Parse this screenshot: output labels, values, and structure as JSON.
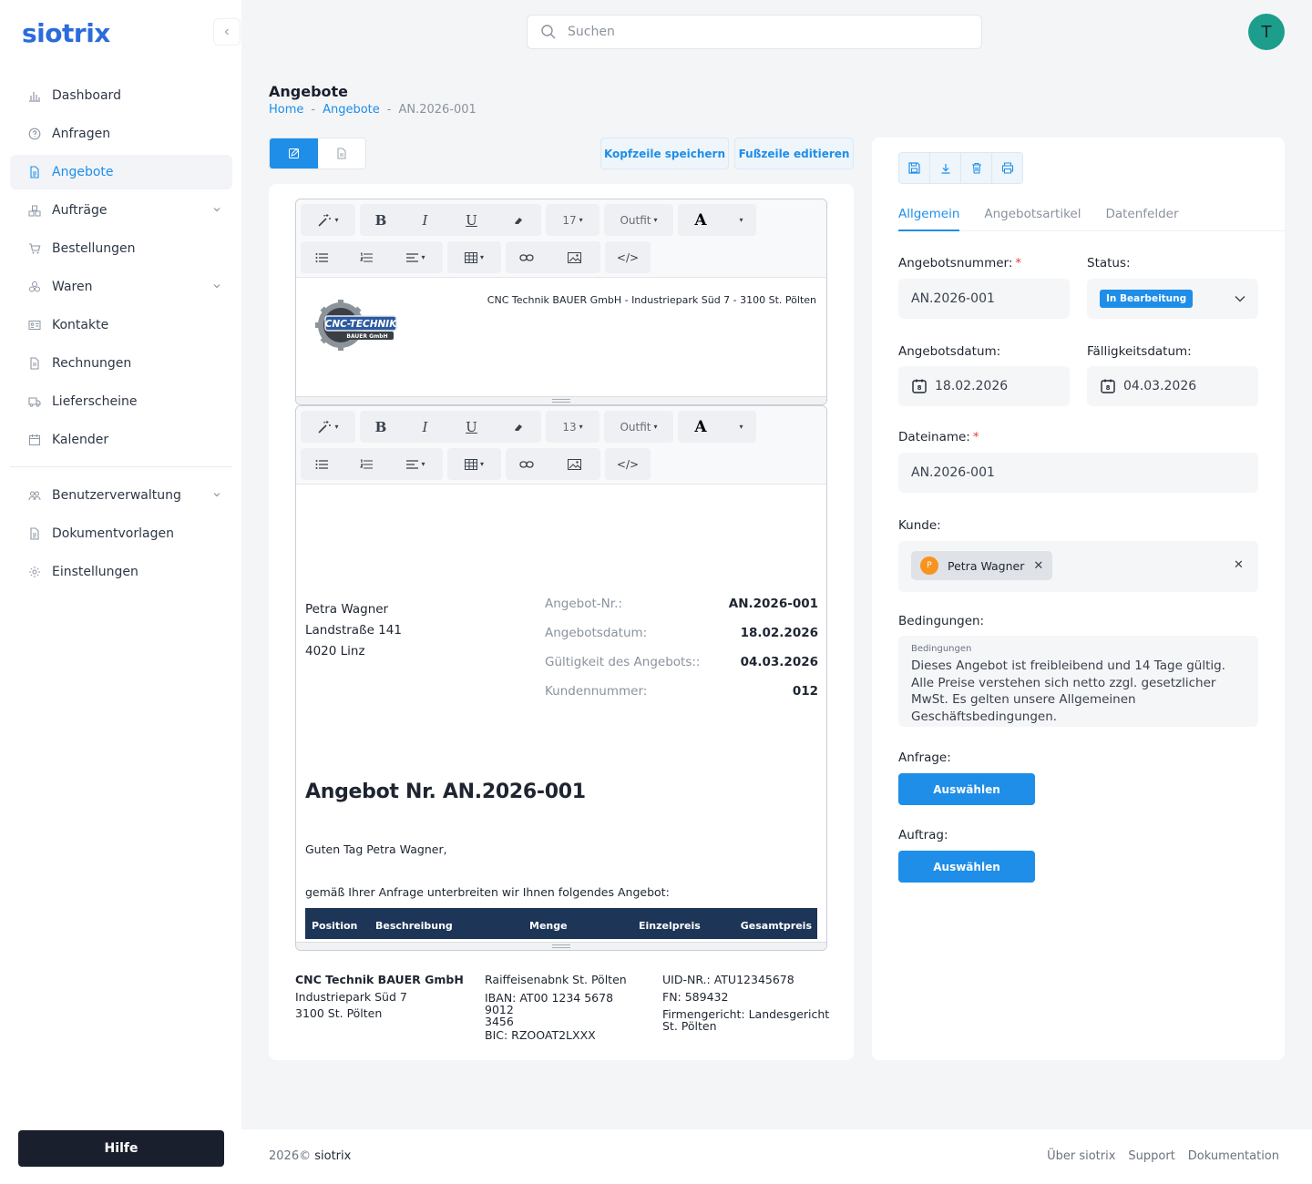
{
  "app": {
    "logo": "siotrix"
  },
  "search": {
    "placeholder": "Suchen"
  },
  "user": {
    "avatar_initial": "T"
  },
  "sidebar": {
    "items": [
      {
        "label": "Dashboard",
        "icon": "bar-chart-icon"
      },
      {
        "label": "Anfragen",
        "icon": "question-circle-icon"
      },
      {
        "label": "Angebote",
        "icon": "document-icon",
        "active": true
      },
      {
        "label": "Aufträge",
        "icon": "boxes-icon",
        "expandable": true
      },
      {
        "label": "Bestellungen",
        "icon": "cart-icon"
      },
      {
        "label": "Waren",
        "icon": "stack-icon",
        "expandable": true
      },
      {
        "label": "Kontakte",
        "icon": "contact-card-icon"
      },
      {
        "label": "Rechnungen",
        "icon": "invoice-icon"
      },
      {
        "label": "Lieferscheine",
        "icon": "truck-icon"
      },
      {
        "label": "Kalender",
        "icon": "calendar-icon"
      }
    ],
    "admin_items": [
      {
        "label": "Benutzerverwaltung",
        "icon": "users-icon",
        "expandable": true
      },
      {
        "label": "Dokumentvorlagen",
        "icon": "template-icon"
      },
      {
        "label": "Einstellungen",
        "icon": "gear-icon"
      }
    ],
    "help_label": "Hilfe"
  },
  "page": {
    "title": "Angebote",
    "breadcrumb": {
      "home": "Home",
      "section": "Angebote",
      "current": "AN.2026-001"
    }
  },
  "editor": {
    "save_header_label": "Kopfzeile speichern",
    "edit_footer_label": "Fußzeile editieren",
    "header_toolbar": {
      "font_size": "17",
      "font_family": "Outfit"
    },
    "body_toolbar": {
      "font_size": "13",
      "font_family": "Outfit"
    },
    "header_address": "CNC Technik BAUER GmbH - Industriepark Süd 7 - 3100 St. Pölten",
    "logo_text_main": "CNC-TECHNIK",
    "logo_text_sub": "BAUER GmbH"
  },
  "document": {
    "recipient": {
      "name": "Petra Wagner",
      "street": "Landstraße 141",
      "city": "4020 Linz"
    },
    "meta": [
      {
        "label": "Angebot-Nr.:",
        "value": "AN.2026-001"
      },
      {
        "label": "Angebotsdatum:",
        "value": "18.02.2026"
      },
      {
        "label": "Gültigkeit des Angebots::",
        "value": "04.03.2026"
      },
      {
        "label": "Kundennummer:",
        "value": "012"
      }
    ],
    "title": "Angebot Nr. AN.2026-001",
    "greeting": "Guten Tag Petra Wagner,",
    "intro": "gemäß Ihrer Anfrage unterbreiten wir Ihnen folgendes Angebot:",
    "table_headers": [
      "Position",
      "Beschreibung",
      "Menge",
      "Einzelpreis",
      "Gesamtpreis"
    ]
  },
  "doc_footer": {
    "col1": [
      "CNC Technik BAUER GmbH",
      "Industriepark Süd 7",
      "3100 St. Pölten"
    ],
    "col2": [
      "Raiffeisenabnk St. Pölten",
      "IBAN: AT00 1234 5678 9012",
      "3456",
      "BIC: RZOOAT2LXXX"
    ],
    "col3": [
      "UID-NR.: ATU12345678",
      "FN: 589432",
      "Firmengericht: Landesgericht",
      "St. Pölten"
    ]
  },
  "form": {
    "tabs": [
      "Allgemein",
      "Angebotsartikel",
      "Datenfelder"
    ],
    "offer_number_label": "Angebotsnummer:",
    "offer_number": "AN.2026-001",
    "status_label": "Status:",
    "status_value": "In Bearbeitung",
    "offer_date_label": "Angebotsdatum:",
    "offer_date": "18.02.2026",
    "due_date_label": "Fälligkeitsdatum:",
    "due_date": "04.03.2026",
    "filename_label": "Dateiname:",
    "filename": "AN.2026-001",
    "customer_label": "Kunde:",
    "customer_initial": "P",
    "customer_name": "Petra Wagner",
    "conditions_label": "Bedingungen:",
    "conditions_inner_label": "Bedingungen",
    "conditions_text": "Dieses Angebot ist freibleibend und 14 Tage gültig. Alle Preise verstehen sich netto zzgl. gesetzlicher MwSt. Es gelten unsere Allgemeinen Geschäftsbedingungen.",
    "inquiry_label": "Anfrage:",
    "order_label": "Auftrag:",
    "select_label": "Auswählen"
  },
  "footer": {
    "year": "2026©",
    "brand": "siotrix",
    "links": [
      "Über siotrix",
      "Support",
      "Dokumentation"
    ]
  },
  "colors": {
    "accent": "#1e8ee8",
    "brand": "#2b6cdc",
    "table_header": "#1d3557",
    "help_button": "#1a1f2e"
  }
}
